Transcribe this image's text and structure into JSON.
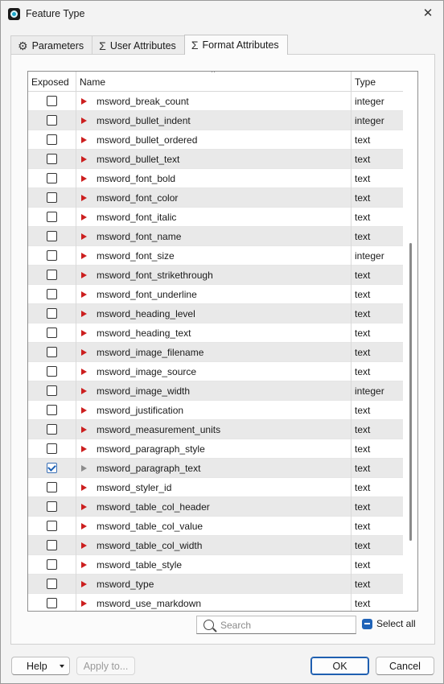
{
  "window": {
    "title": "Feature Type"
  },
  "tabs": [
    {
      "label": "Parameters",
      "icon": "gear-icon"
    },
    {
      "label": "User Attributes",
      "icon": "sigma-icon"
    },
    {
      "label": "Format Attributes",
      "icon": "sigma-icon"
    }
  ],
  "active_tab": "Format Attributes",
  "table": {
    "columns": {
      "exposed": "Exposed",
      "name": "Name",
      "type": "Type"
    },
    "rows": [
      {
        "name": "msword_break_count",
        "type": "integer",
        "exposed": false
      },
      {
        "name": "msword_bullet_indent",
        "type": "integer",
        "exposed": false
      },
      {
        "name": "msword_bullet_ordered",
        "type": "text",
        "exposed": false
      },
      {
        "name": "msword_bullet_text",
        "type": "text",
        "exposed": false
      },
      {
        "name": "msword_font_bold",
        "type": "text",
        "exposed": false
      },
      {
        "name": "msword_font_color",
        "type": "text",
        "exposed": false
      },
      {
        "name": "msword_font_italic",
        "type": "text",
        "exposed": false
      },
      {
        "name": "msword_font_name",
        "type": "text",
        "exposed": false
      },
      {
        "name": "msword_font_size",
        "type": "integer",
        "exposed": false
      },
      {
        "name": "msword_font_strikethrough",
        "type": "text",
        "exposed": false
      },
      {
        "name": "msword_font_underline",
        "type": "text",
        "exposed": false
      },
      {
        "name": "msword_heading_level",
        "type": "text",
        "exposed": false
      },
      {
        "name": "msword_heading_text",
        "type": "text",
        "exposed": false
      },
      {
        "name": "msword_image_filename",
        "type": "text",
        "exposed": false
      },
      {
        "name": "msword_image_source",
        "type": "text",
        "exposed": false
      },
      {
        "name": "msword_image_width",
        "type": "integer",
        "exposed": false
      },
      {
        "name": "msword_justification",
        "type": "text",
        "exposed": false
      },
      {
        "name": "msword_measurement_units",
        "type": "text",
        "exposed": false
      },
      {
        "name": "msword_paragraph_style",
        "type": "text",
        "exposed": false
      },
      {
        "name": "msword_paragraph_text",
        "type": "text",
        "exposed": true
      },
      {
        "name": "msword_styler_id",
        "type": "text",
        "exposed": false
      },
      {
        "name": "msword_table_col_header",
        "type": "text",
        "exposed": false
      },
      {
        "name": "msword_table_col_value",
        "type": "text",
        "exposed": false
      },
      {
        "name": "msword_table_col_width",
        "type": "text",
        "exposed": false
      },
      {
        "name": "msword_table_style",
        "type": "text",
        "exposed": false
      },
      {
        "name": "msword_type",
        "type": "text",
        "exposed": false
      },
      {
        "name": "msword_use_markdown",
        "type": "text",
        "exposed": false
      }
    ]
  },
  "search": {
    "placeholder": "Search",
    "value": ""
  },
  "select_all": {
    "label": "Select all",
    "state": "indeterminate"
  },
  "buttons": {
    "help": "Help",
    "apply": "Apply to...",
    "ok": "OK",
    "cancel": "Cancel"
  },
  "colors": {
    "accent": "#1f63b8",
    "arrow": "#cc1f1f",
    "row_alt": "#e9e9e9"
  }
}
